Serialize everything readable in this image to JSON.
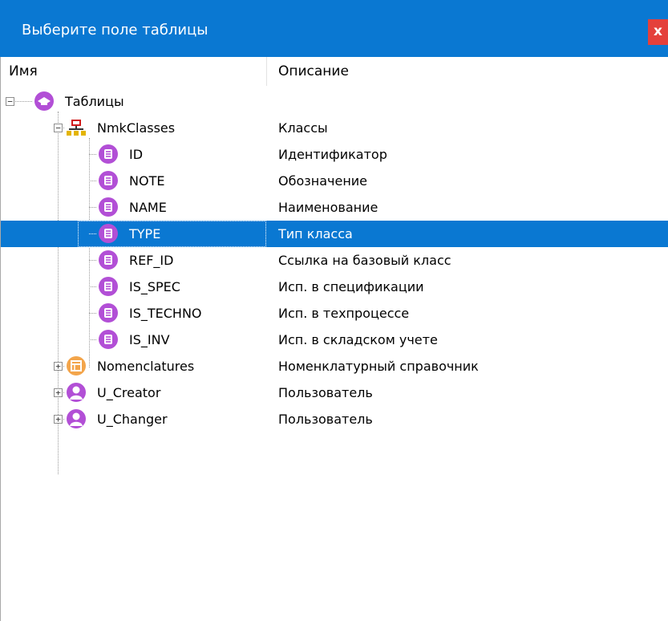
{
  "window": {
    "title": "Выберите поле таблицы",
    "close_label": "x",
    "accent_color": "#0a78d2"
  },
  "columns": {
    "name": "Имя",
    "description": "Описание"
  },
  "tree": [
    {
      "name": "Таблицы",
      "description": "",
      "icon": "tables-icon",
      "expander": "⊟",
      "level": 0
    },
    {
      "name": "NmkClasses",
      "description": "Классы",
      "icon": "network-icon",
      "expander": "⊟",
      "level": 1
    },
    {
      "name": "ID",
      "description": "Идентификатор",
      "icon": "field-icon",
      "level": 2
    },
    {
      "name": "NOTE",
      "description": "Обозначение",
      "icon": "field-icon",
      "level": 2
    },
    {
      "name": "NAME",
      "description": "Наименование",
      "icon": "field-icon",
      "level": 2
    },
    {
      "name": "TYPE",
      "description": "Тип класса",
      "icon": "field-icon",
      "level": 2,
      "selected": true
    },
    {
      "name": "REF_ID",
      "description": "Ссылка на базовый класс",
      "icon": "field-icon",
      "level": 2
    },
    {
      "name": "IS_SPEC",
      "description": "Исп. в спецификации",
      "icon": "field-icon",
      "level": 2
    },
    {
      "name": "IS_TECHNO",
      "description": "Исп. в техпроцессе",
      "icon": "field-icon",
      "level": 2
    },
    {
      "name": "IS_INV",
      "description": "Исп. в складском учете",
      "icon": "field-icon",
      "level": 2
    },
    {
      "name": "Nomenclatures",
      "description": "Номенклатурный справочник",
      "icon": "table-ref-icon",
      "expander": "⊞",
      "level": 1
    },
    {
      "name": "U_Creator",
      "description": "Пользователь",
      "icon": "user-icon",
      "expander": "⊞",
      "level": 1
    },
    {
      "name": "U_Changer",
      "description": "Пользователь",
      "icon": "user-icon",
      "expander": "⊞",
      "level": 1
    }
  ]
}
